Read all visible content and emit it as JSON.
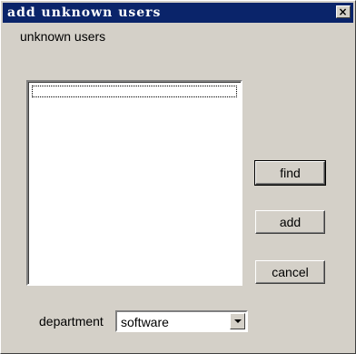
{
  "window": {
    "title": "add unknown users",
    "close_glyph": "×"
  },
  "list": {
    "label": "unknown users",
    "items": []
  },
  "buttons": {
    "find": "find",
    "add": "add",
    "cancel": "cancel"
  },
  "department": {
    "label": "department",
    "selected": "software"
  },
  "icons": {
    "close": "close-icon",
    "dropdown": "chevron-down-icon"
  }
}
